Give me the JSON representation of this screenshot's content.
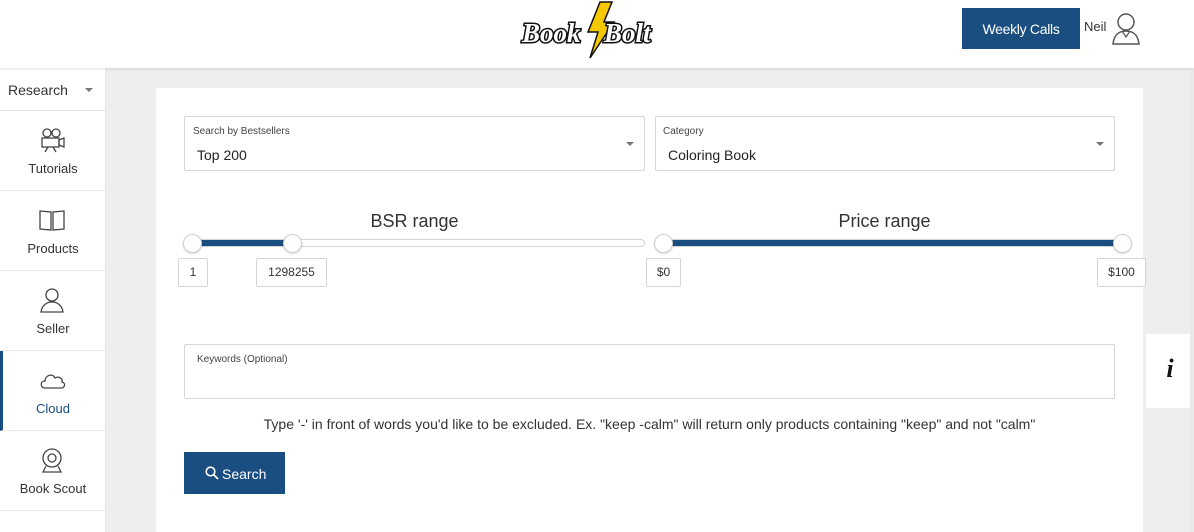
{
  "header": {
    "logo_text": "Book Bolt",
    "weekly_calls_label": "Weekly Calls",
    "user_name": "Neil"
  },
  "sidebar": {
    "section_select": "Research",
    "items": [
      {
        "label": "Tutorials",
        "icon": "camera-icon"
      },
      {
        "label": "Products",
        "icon": "book-icon"
      },
      {
        "label": "Seller",
        "icon": "user-icon"
      },
      {
        "label": "Cloud",
        "icon": "cloud-icon",
        "active": true
      },
      {
        "label": "Book Scout",
        "icon": "webcam-icon"
      }
    ]
  },
  "filters": {
    "bestsellers": {
      "label": "Search by Bestsellers",
      "value": "Top 200"
    },
    "category": {
      "label": "Category",
      "value": "Coloring Book"
    }
  },
  "bsr_range": {
    "title": "BSR range",
    "min": "1",
    "max": "1298255",
    "fill_fraction_start": 0,
    "fill_fraction_end": 0.22
  },
  "price_range": {
    "title": "Price range",
    "min": "$0",
    "max": "$100",
    "fill_fraction_start": 0,
    "fill_fraction_end": 1
  },
  "keywords": {
    "label": "Keywords (Optional)",
    "value": "",
    "hint": "Type '-' in front of words you'd like to be excluded. Ex. \"keep -calm\" will return only products containing \"keep\" and not \"calm\""
  },
  "search_button_label": "Search",
  "info_tab_glyph": "i",
  "colors": {
    "primary": "#1a4d80",
    "logo_yellow": "#f5c800"
  }
}
